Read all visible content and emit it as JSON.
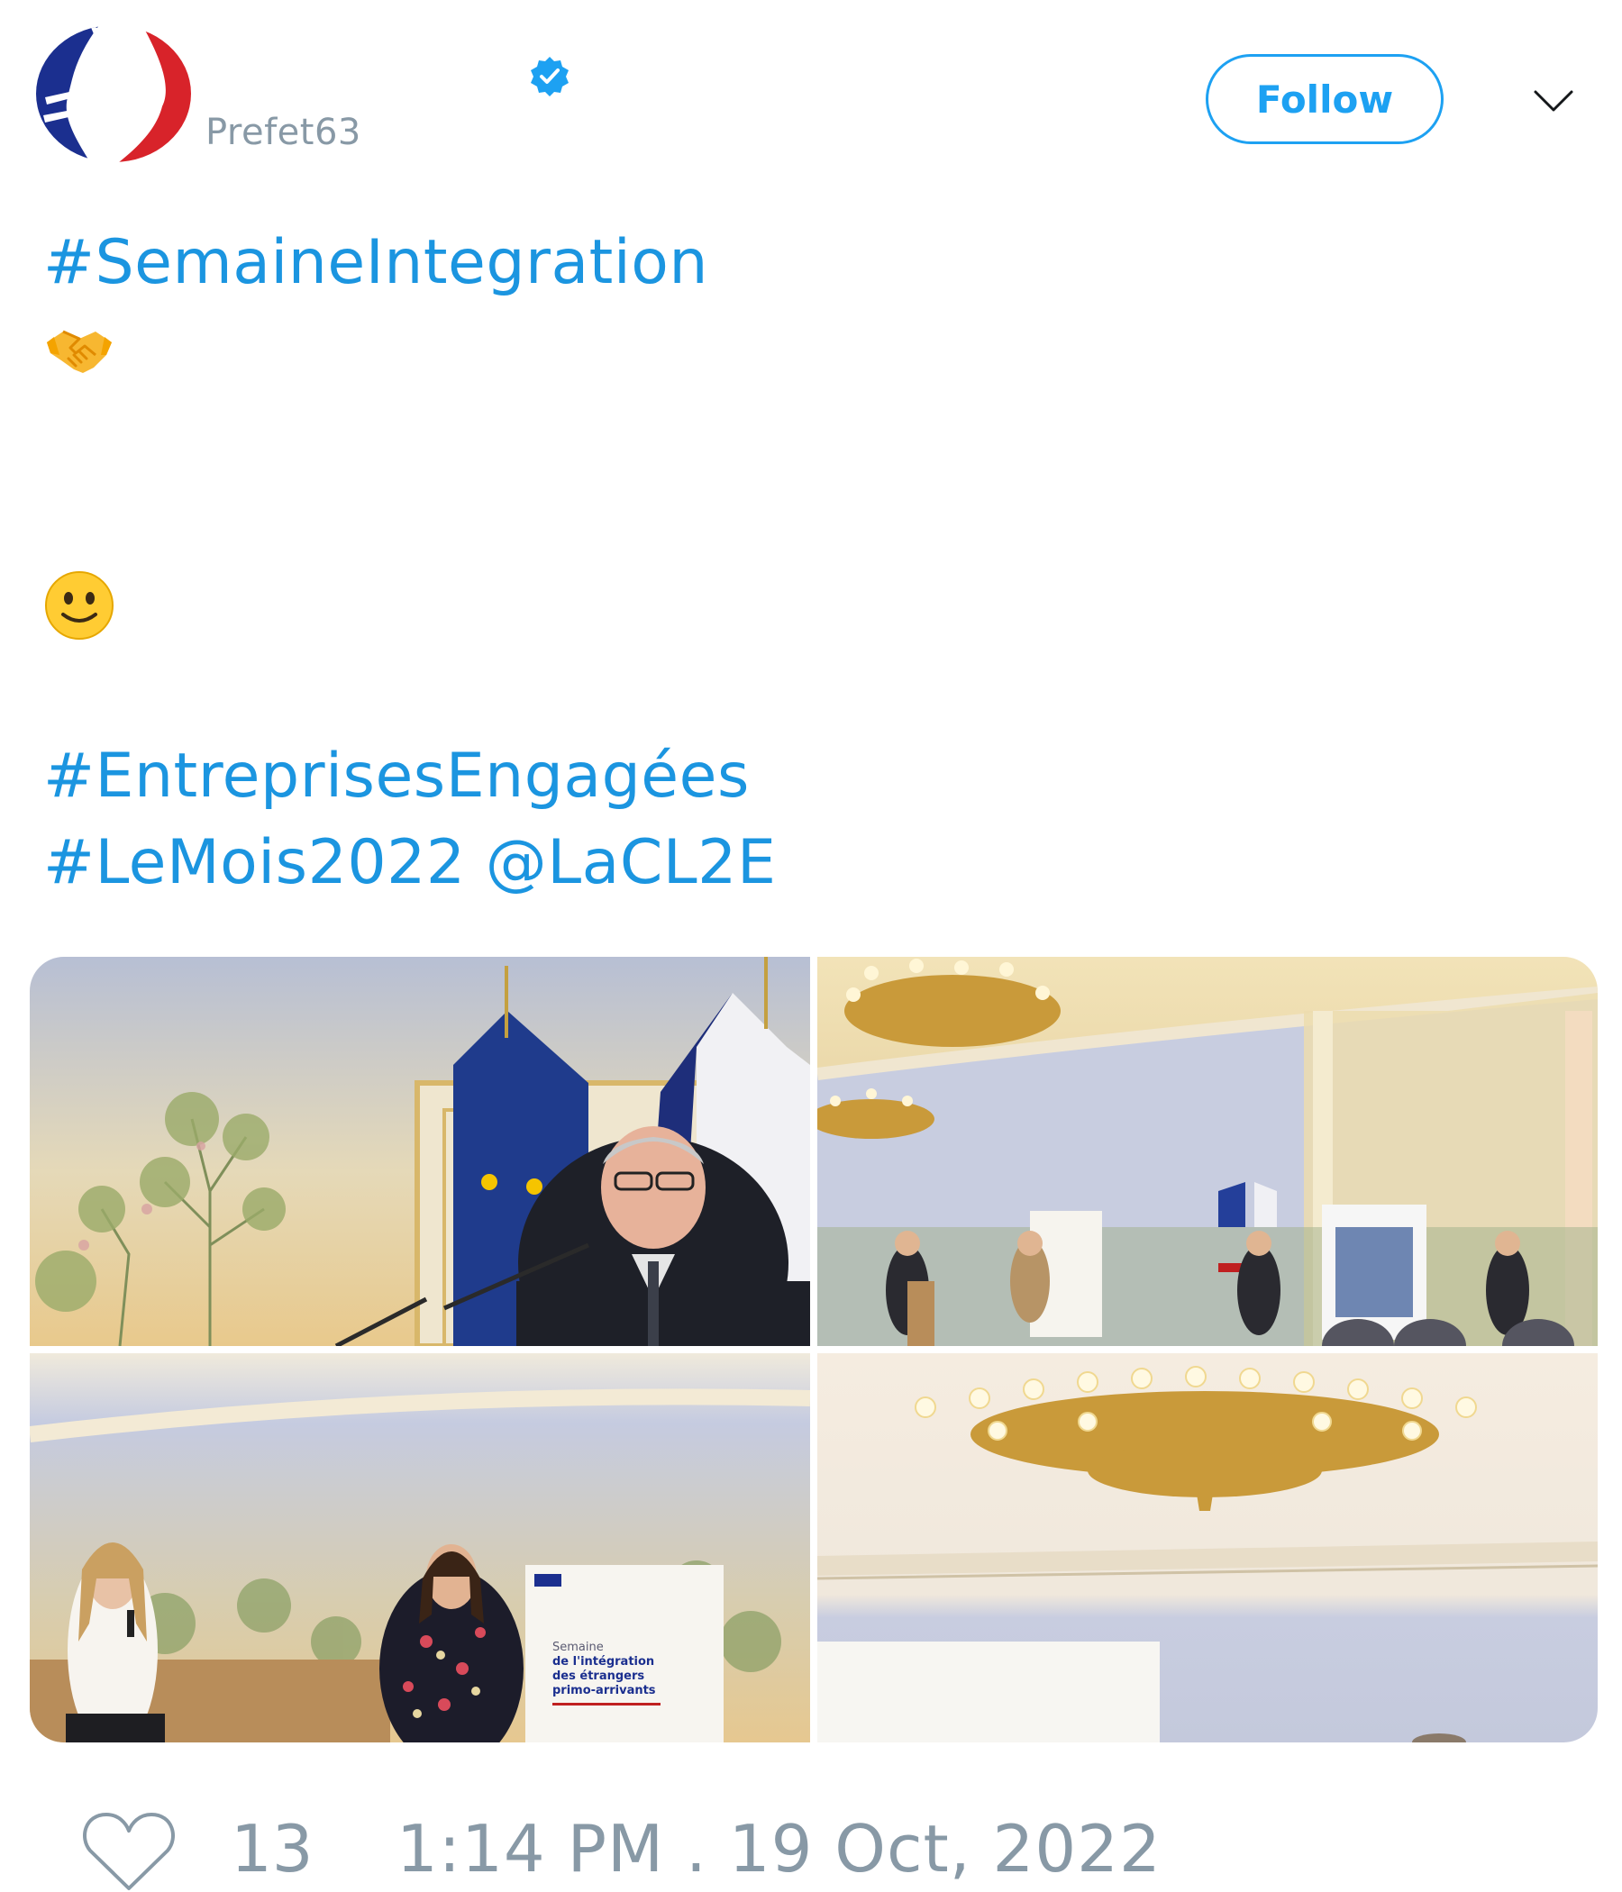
{
  "user": {
    "display_name": "",
    "handle": "Prefet63",
    "verified": true,
    "avatar_icon": "marianne-logo-icon"
  },
  "header": {
    "follow_label": "Follow",
    "menu_icon": "chevron-down-icon"
  },
  "tweet": {
    "line1": "#SemaineIntegration",
    "emoji1": "handshake-emoji",
    "emoji2": "smiling-face-emoji",
    "line3": "#EntreprisesEngagées",
    "line4": "#LeMois2022 @LaCL2E"
  },
  "media": {
    "photos": [
      {
        "name": "photo-speaker-with-flags"
      },
      {
        "name": "photo-ceremony-hall"
      },
      {
        "name": "photo-two-women-speaking",
        "banner_title": "Semaine",
        "banner_lines": [
          "de l'intégration",
          "des étrangers",
          "primo-arrivants"
        ]
      },
      {
        "name": "photo-chandelier"
      }
    ]
  },
  "footer": {
    "like_icon": "heart-icon",
    "like_count": "13",
    "timestamp": "1:14 PM . 19 Oct, 2022"
  },
  "colors": {
    "link": "#1b95e0",
    "accent": "#1da1f2",
    "muted": "#8899a6"
  }
}
